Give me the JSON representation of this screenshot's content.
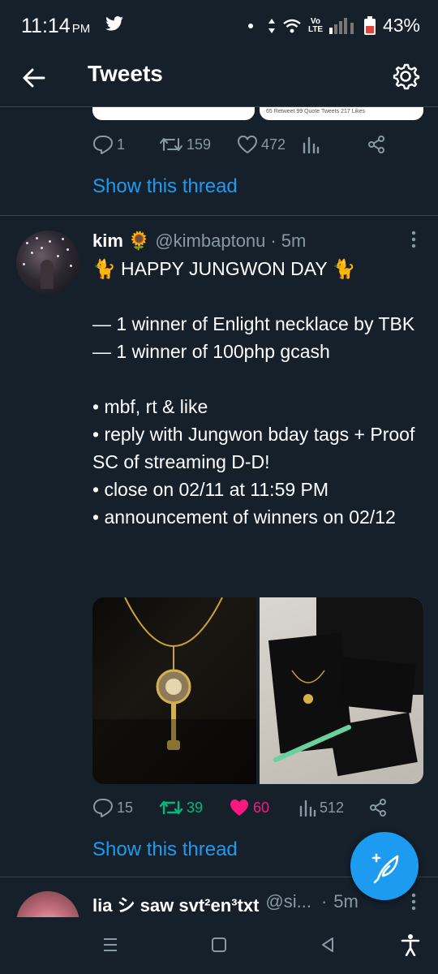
{
  "status_bar": {
    "time": "11:14",
    "ampm": "PM",
    "volte": "Vo LTE",
    "battery": "43%",
    "icons": [
      "twitter-bird-icon",
      "dot-icon",
      "data-arrows-icon",
      "wifi-icon",
      "signal-icon",
      "battery-icon"
    ]
  },
  "appbar": {
    "title": "Tweets",
    "back_icon": "arrow-left-icon",
    "settings_icon": "gear-icon"
  },
  "previous_tweet": {
    "embed_text": "65 Retweet   99 Quote Tweets   217 Likes",
    "replies": "1",
    "retweets": "159",
    "likes": "472",
    "show_thread": "Show this thread"
  },
  "tweet": {
    "name": "kim",
    "name_emoji": "🌻",
    "handle": "@kimbaptonu",
    "sep": "·",
    "time": "5m",
    "lines": [
      "🐈 HAPPY JUNGWON DAY 🐈",
      "",
      "— 1 winner of Enlight necklace by TBK",
      "— 1 winner of 100php gcash",
      "",
      "• mbf, rt & like",
      "• reply with Jungwon bday tags + Proof SC of  streaming D-D!",
      "• close on 02/11 at 11:59 PM",
      "• announcement of winners on 02/12"
    ],
    "replies": "15",
    "retweets": "39",
    "likes": "60",
    "views": "512",
    "show_thread": "Show this thread"
  },
  "next_tweet": {
    "name": "lia シ saw svt²en³txt",
    "handle": "@si...",
    "sep": "·",
    "time": "5m"
  },
  "colors": {
    "background": "#15202b",
    "accent": "#1d9bf0",
    "muted": "#8899a6",
    "retweet_active": "#00ba7c",
    "like_active": "#f91880"
  }
}
